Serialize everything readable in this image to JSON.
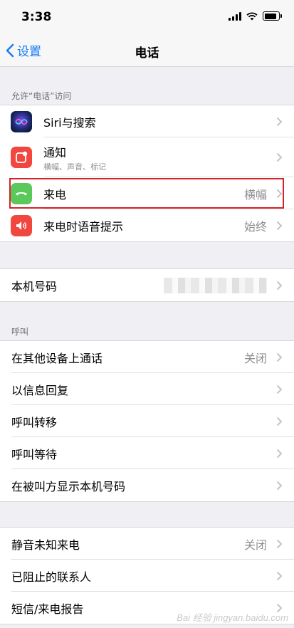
{
  "status": {
    "time": "3:38"
  },
  "nav": {
    "back_label": "设置",
    "title": "电话"
  },
  "section1": {
    "header": "允许“电话”访问",
    "items": [
      {
        "label": "Siri与搜索",
        "value": ""
      },
      {
        "label": "通知",
        "sub": "横幅、声音、标记",
        "value": ""
      },
      {
        "label": "来电",
        "value": "横幅"
      },
      {
        "label": "来电时语音提示",
        "value": "始终"
      }
    ]
  },
  "section2": {
    "items": [
      {
        "label": "本机号码",
        "value": ""
      }
    ]
  },
  "section3": {
    "header": "呼叫",
    "items": [
      {
        "label": "在其他设备上通话",
        "value": "关闭"
      },
      {
        "label": "以信息回复",
        "value": ""
      },
      {
        "label": "呼叫转移",
        "value": ""
      },
      {
        "label": "呼叫等待",
        "value": ""
      },
      {
        "label": "在被叫方显示本机号码",
        "value": ""
      }
    ]
  },
  "section4": {
    "items": [
      {
        "label": "静音未知来电",
        "value": "关闭"
      },
      {
        "label": "已阻止的联系人",
        "value": ""
      },
      {
        "label": "短信/来电报告",
        "value": ""
      }
    ]
  },
  "watermark": "Bai 经验 jingyan.baidu.com",
  "colors": {
    "accent": "#1a7cf4",
    "highlight": "#d4242a"
  },
  "icons": [
    "siri-icon",
    "notifications-icon",
    "incoming-call-icon",
    "speaker-icon",
    "chevron-right-icon",
    "back-chevron-icon"
  ]
}
